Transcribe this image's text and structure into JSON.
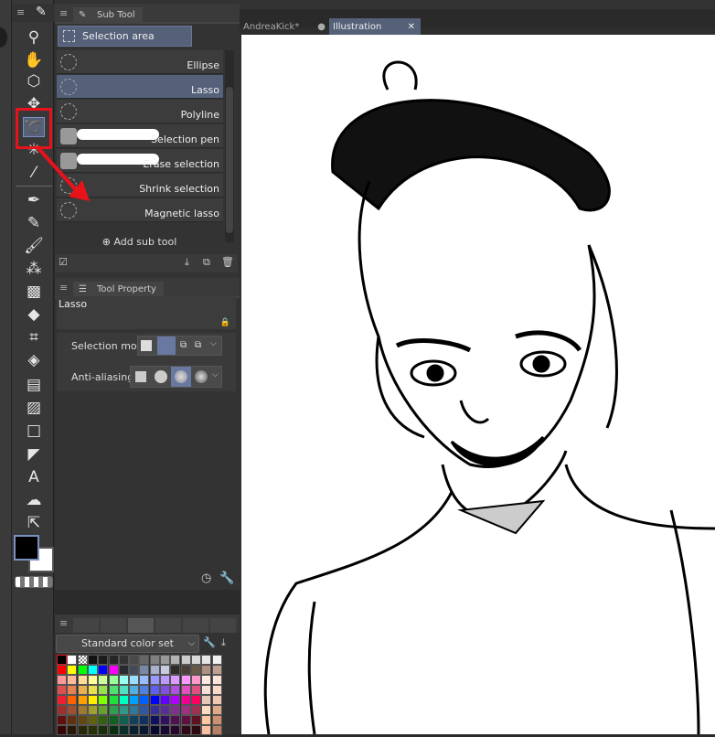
{
  "toolbar": {
    "tools": [
      "zoom-icon",
      "hand-icon",
      "object-select-icon",
      "move-icon",
      "lasso-selection-icon",
      "auto-select-icon",
      "eyedropper-icon",
      "pen-icon",
      "pencil-icon",
      "brush-icon",
      "airbrush-icon",
      "decoration-icon",
      "eraser-icon",
      "blend-icon",
      "fill-icon",
      "frame-icon",
      "gradient-icon",
      "figure-icon",
      "ruler-icon",
      "text-icon",
      "balloon-icon",
      "correct-line-icon"
    ],
    "main_color": "#000000",
    "sub_color": "#ffffff"
  },
  "subtool": {
    "tab_label": "Sub Tool",
    "group": "Selection area",
    "items": [
      {
        "label": "Ellipse"
      },
      {
        "label": "Lasso",
        "selected": true
      },
      {
        "label": "Polyline"
      },
      {
        "label": "Selection pen"
      },
      {
        "label": "Erase selection"
      },
      {
        "label": "Shrink selection"
      },
      {
        "label": "Magnetic lasso"
      }
    ],
    "add_label": "Add sub tool"
  },
  "toolprop": {
    "tab_label": "Tool Property",
    "tool_name": "Lasso",
    "selection_mode_label": "Selection mode",
    "anti_aliasing_label": "Anti-aliasing"
  },
  "palette": {
    "set_name": "Standard color set",
    "rows": [
      [
        "#000000",
        "#ffffff",
        "transparent",
        "#111111",
        "#1c1c1c",
        "#262626",
        "#333333",
        "#4a4a4a",
        "#666666",
        "#808080",
        "#999999",
        "#b3b3b3",
        "#cccccc",
        "#d9d9d9",
        "#e6e6e6",
        "#f2f2f2"
      ],
      [
        "#ff0000",
        "#ffff00",
        "#00ff00",
        "#00ffff",
        "#0000ff",
        "#ff00ff",
        "#2a2a30",
        "#444a58",
        "#7a88a8",
        "#a8b0cc",
        "#c8cce0",
        "#302c28",
        "#4a4038",
        "#6a5848",
        "#b09080",
        "#c0a090"
      ],
      [
        "#ff9999",
        "#ffbb99",
        "#ffdd99",
        "#ffff99",
        "#ccff99",
        "#99ff99",
        "#99ffee",
        "#99ddff",
        "#99bbff",
        "#9999ff",
        "#bb99ff",
        "#dd99ff",
        "#ff99ff",
        "#ff99cc",
        "#fee8e0",
        "#fee4d8"
      ],
      [
        "#e05050",
        "#e88050",
        "#e8b050",
        "#e8e050",
        "#98e050",
        "#50e070",
        "#50e0c0",
        "#50b0e0",
        "#5080e0",
        "#6060f0",
        "#8050e0",
        "#b050e0",
        "#e050c0",
        "#e05080",
        "#f8e0d8",
        "#fcd8c8"
      ],
      [
        "#f02030",
        "#ff6000",
        "#ffa000",
        "#ffee00",
        "#80ff00",
        "#20e040",
        "#00ffc0",
        "#00a0ff",
        "#0060ff",
        "#0000ff",
        "#6000ff",
        "#b000ff",
        "#f00090",
        "#ff0060",
        "#e8c8b8",
        "#f0c8b0"
      ],
      [
        "#a03030",
        "#a05030",
        "#a07830",
        "#a0a030",
        "#68a030",
        "#30a050",
        "#309888",
        "#307898",
        "#3058a0",
        "#383098",
        "#583098",
        "#803090",
        "#a03080",
        "#a03050",
        "#fcdcc0",
        "#e0a888"
      ],
      [
        "#601010",
        "#603010",
        "#604810",
        "#606010",
        "#306010",
        "#106020",
        "#106050",
        "#104060",
        "#103060",
        "#101060",
        "#301060",
        "#501050",
        "#601040",
        "#601020",
        "#fcc8a0",
        "#d09070"
      ],
      [
        "#380808",
        "#281808",
        "#282808",
        "#283008",
        "#183008",
        "#083010",
        "#083028",
        "#082030",
        "#081830",
        "#080830",
        "#180830",
        "#280828",
        "#300818",
        "#300810",
        "#f8c0a0",
        "#b88060"
      ]
    ]
  },
  "canvas": {
    "tabs": [
      {
        "label": "AndreaKick*"
      },
      {
        "label": "Illustration",
        "active": true
      }
    ]
  },
  "annotation_color": "#e8121b"
}
